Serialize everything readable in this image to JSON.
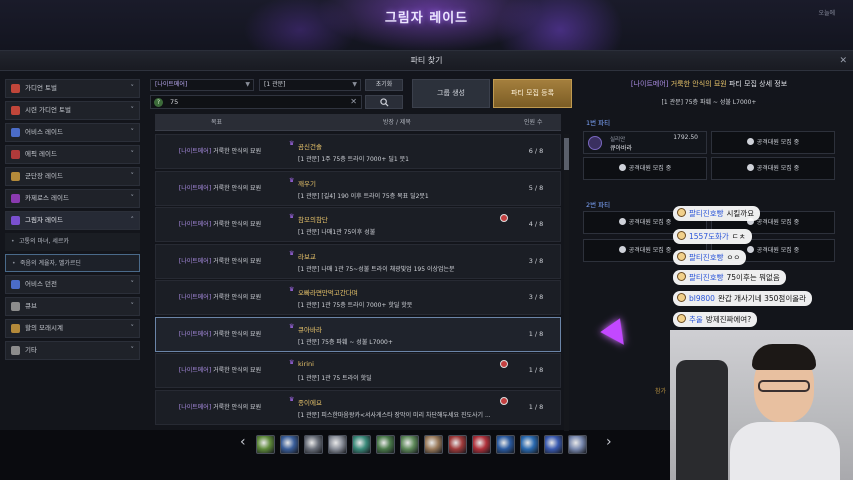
{
  "scene": {
    "title": "그림자 레이드",
    "mini_label": "오늘에"
  },
  "window": {
    "title": "파티 찾기",
    "close": "✕"
  },
  "sidebar": {
    "categories": [
      {
        "label": "가디언 토벌",
        "icon_color": "#c0463a"
      },
      {
        "label": "시련 가디언 토벌",
        "icon_color": "#c0463a"
      },
      {
        "label": "어비스 레이드",
        "icon_color": "#4b6cc8"
      },
      {
        "label": "에픽 레이드",
        "icon_color": "#b03a3a"
      },
      {
        "label": "군단장 레이드",
        "icon_color": "#b48a3a"
      },
      {
        "label": "카제로스 레이드",
        "icon_color": "#8a3ab0"
      },
      {
        "label": "그림자 레이드",
        "icon_color": "#7a50d0"
      }
    ],
    "subitems": [
      {
        "label": "고통의 마녀, 세르카"
      },
      {
        "label": "죽음의 계율자, 벨가르딘"
      }
    ],
    "more_categories": [
      {
        "label": "어비스 던전",
        "icon_color": "#4b6cc8"
      },
      {
        "label": "큐브",
        "icon_color": "#8c8c8c"
      },
      {
        "label": "할의 모래시계",
        "icon_color": "#b48a3a"
      },
      {
        "label": "기타",
        "icon_color": "#8c8c8c"
      }
    ]
  },
  "filters": {
    "raid_select": "[나이트메어]",
    "gate_select": "[1 관문]",
    "reset_label": "초기화",
    "search_value": "75",
    "search_prefix": "?",
    "clear": "✕",
    "group_button": "그룹 생성",
    "recruit_button": "파티 모집 등록"
  },
  "table": {
    "headers": {
      "goal": "목표",
      "desc": "방장 / 제목",
      "count": "인원 수"
    },
    "rows": [
      {
        "tag": "[나이트메어]",
        "goal": "거룩한 안식의 묘원",
        "owner": "곰신건솔",
        "desc": "[1 관문] 1주 75층 트라이 7000+ 딜1 뭇1",
        "count": "6 / 8",
        "locked": false
      },
      {
        "tag": "[나이트메어]",
        "goal": "거룩한 안식의 묘원",
        "owner": "깨우기",
        "desc": "[1 관문] [길4] 190 이후 트라이 75층 목표 딜2뭇1",
        "count": "5 / 8",
        "locked": false
      },
      {
        "tag": "[나이트메어]",
        "goal": "거룩한 안식의 묘원",
        "owner": "참모의참단",
        "desc": "[1 관문] 나매1관 75이후 성불",
        "count": "4 / 8",
        "locked": true
      },
      {
        "tag": "[나이트메어]",
        "goal": "거룩한 안식의 묘원",
        "owner": "라보교",
        "desc": "[1 관문] 나매 1관 75~성불 트라이 채광빛업 195 이상업는분",
        "count": "3 / 8",
        "locked": false
      },
      {
        "tag": "[나이트메어]",
        "goal": "거룩한 안식의 묘원",
        "owner": "오빠라면만먹고간다며",
        "desc": "[1 관문] 1관 75층 트라이 7000+ 핫딜 핫뭇",
        "count": "3 / 8",
        "locked": false
      },
      {
        "tag": "[나이트메어]",
        "goal": "거룩한 안식의 묘원",
        "owner": "큐아바라",
        "desc": "[1 관문] 75층 파훼 ~ 성불 L7000+",
        "count": "1 / 8",
        "locked": false,
        "highlight": true
      },
      {
        "tag": "[나이트메어]",
        "goal": "거룩한 안식의 묘원",
        "owner": "kirini",
        "desc": "[1 관문] 1관 75 트라이 핫딜",
        "count": "1 / 8",
        "locked": true
      },
      {
        "tag": "[나이트메어]",
        "goal": "거룩한 안식의 묘원",
        "owner": "종이에요",
        "desc": "[1 관문] 피스한마음왕카<서사게스타 장막이 미리 차단해두세요 진도사기 ...",
        "count": "1 / 8",
        "locked": true
      }
    ]
  },
  "detail": {
    "title_tag": "[나이트메어]",
    "title_name": "거룩한 안식의 묘원",
    "title_suffix": "파티 모집 상세 정보",
    "subtitle": "[1 관문] 75층 파훼 ~ 성불 L7000+",
    "party1_label": "1번 파티",
    "party2_label": "2번 파티",
    "member": {
      "class": "실리안",
      "name": "큐아바라",
      "ilvl": "1792.50"
    },
    "slot_label": "공격대원 모집 중",
    "bottom_note": "참가"
  },
  "chat": [
    {
      "name": "팔티진호빵",
      "text": "시킬까요"
    },
    {
      "name": "1557도화가",
      "text": "ㄷㅊ"
    },
    {
      "name": "팔티진호빵",
      "text": "ㅇㅇ"
    },
    {
      "name": "팔티진호빵",
      "text": "75이후는 뭐없음"
    },
    {
      "name": "bl9800",
      "text": "완갑 개사기네 350점이올라"
    },
    {
      "name": "추울",
      "text": "방제진짜에여?"
    }
  ],
  "skillbar": {
    "left_arrow": "‹",
    "right_arrow": "›",
    "icons": [
      {
        "name": "gift-box-icon",
        "color": "#5e8a3a"
      },
      {
        "name": "scroll-blue-icon",
        "color": "#3a5e9a"
      },
      {
        "name": "rune-gray-icon",
        "color": "#6a6f7a"
      },
      {
        "name": "feather-icon",
        "color": "#8a8f9a"
      },
      {
        "name": "orb-teal-icon",
        "color": "#3a8a7a"
      },
      {
        "name": "potion-green-icon",
        "color": "#4a7a4a"
      },
      {
        "name": "leaf-icon",
        "color": "#5e8a5a"
      },
      {
        "name": "flower-icon",
        "color": "#9a7a5a"
      },
      {
        "name": "ruby-orb-icon",
        "color": "#a03a3a"
      },
      {
        "name": "crimson-orb-icon",
        "color": "#b0303a"
      },
      {
        "name": "gear-blue-icon",
        "color": "#2a5aa0"
      },
      {
        "name": "sapphire-orb-icon",
        "color": "#2a6ab0"
      },
      {
        "name": "moon-orb-icon",
        "color": "#3a5ab0"
      },
      {
        "name": "pearl-orb-icon",
        "color": "#7a8ab0"
      }
    ]
  }
}
